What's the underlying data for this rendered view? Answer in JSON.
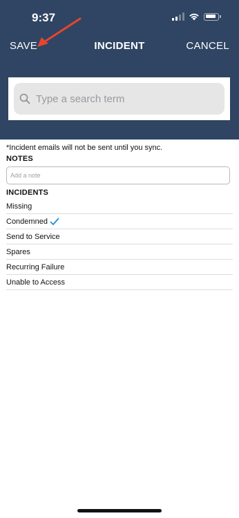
{
  "status_bar": {
    "time": "9:37"
  },
  "nav": {
    "save_label": "SAVE",
    "title": "INCIDENT",
    "cancel_label": "CANCEL"
  },
  "search": {
    "placeholder": "Type a search term",
    "value": ""
  },
  "sync_notice": "*Incident emails will not be sent until you sync.",
  "notes": {
    "label": "NOTES",
    "placeholder": "Add a note",
    "value": ""
  },
  "incidents": {
    "label": "INCIDENTS",
    "items": [
      {
        "label": "Missing",
        "checked": false
      },
      {
        "label": "Condemned",
        "checked": true
      },
      {
        "label": "Send to Service",
        "checked": false
      },
      {
        "label": "Spares",
        "checked": false
      },
      {
        "label": "Recurring Failure",
        "checked": false
      },
      {
        "label": "Unable to Access",
        "checked": false
      }
    ]
  },
  "colors": {
    "header_bg": "#2f4563",
    "check": "#1e8fd6",
    "annotation_arrow": "#e8452c"
  }
}
